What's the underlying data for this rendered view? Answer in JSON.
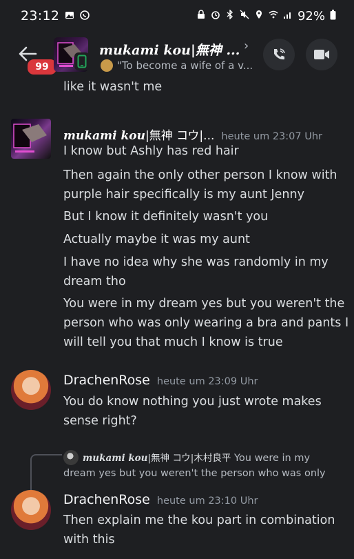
{
  "status_bar": {
    "time": "23:12",
    "battery": "92%"
  },
  "header": {
    "unread_badge": "99",
    "title": "mukami kou|無神 ...",
    "subtitle": "\"To become a wife of a v..."
  },
  "messages": {
    "prev_tail": "like it wasn't me",
    "group1": {
      "author_latin": "mukami kou",
      "author_cjk": "|無神 コウ|...",
      "timestamp": "heute um 23:07 Uhr",
      "lines": [
        "I know but Ashly has red hair",
        "Then again the only other person I know with",
        "purple hair specifically is my aunt Jenny",
        "But I know it definitely wasn't you",
        "Actually maybe it was my aunt",
        "I have no idea why she was randomly in my",
        "dream tho",
        "You were in my dream yes but you weren't the",
        "person who was only wearing a bra and pants I",
        "will tell you that much I know is true"
      ]
    },
    "group2": {
      "author": "DrachenRose",
      "timestamp": "heute um 23:09 Uhr",
      "lines": [
        "You do know nothing you just wrote makes",
        "sense right?"
      ]
    },
    "reply": {
      "author_latin": "mukami kou",
      "author_cjk": "|無神 コウ|木村良平",
      "text_line1": " You were in my",
      "text_line2": "dream yes but you weren't the person who was only"
    },
    "group3": {
      "author": "DrachenRose",
      "timestamp": "heute um 23:10 Uhr",
      "lines": [
        "Then explain me the kou part in combination",
        "with this"
      ]
    }
  },
  "colors": {
    "background": "#1e1f22",
    "text": "#dbdee1",
    "muted": "#949ba4",
    "badge": "#da373c"
  }
}
